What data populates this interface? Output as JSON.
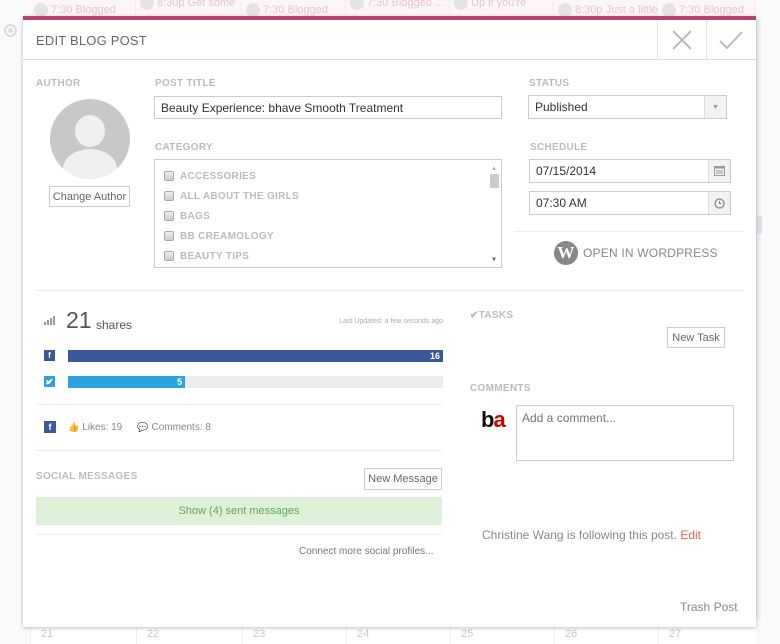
{
  "background": {
    "events": [
      {
        "time": "7:30",
        "text": "Blogged"
      },
      {
        "time": "8:30p",
        "text": "Get some"
      },
      {
        "time": "7:30",
        "text": "Blogged"
      },
      {
        "time": "7:30",
        "text": "Blogged ..."
      },
      {
        "time": "",
        "text": "Up if you're"
      },
      {
        "time": "8:30p",
        "text": "Just a little"
      },
      {
        "time": "7:30",
        "text": "Blogged"
      }
    ],
    "days": [
      "21",
      "22",
      "23",
      "24",
      "25",
      "26",
      "27"
    ]
  },
  "modal": {
    "title": "EDIT BLOG POST",
    "accent_color": "#b5426f",
    "close_icon": "close-icon",
    "confirm_icon": "check-icon"
  },
  "author": {
    "label": "AUTHOR",
    "change_button": "Change Author"
  },
  "post": {
    "title_label": "POST TITLE",
    "title_value": "Beauty Experience: bhave Smooth Treatment",
    "category_label": "CATEGORY",
    "categories": [
      {
        "name": "ACCESSORIES",
        "checked": false
      },
      {
        "name": "ALL ABOUT THE GIRLS",
        "checked": false
      },
      {
        "name": "BAGS",
        "checked": false
      },
      {
        "name": "BB CREAMOLOGY",
        "checked": false
      },
      {
        "name": "BEAUTY TIPS",
        "checked": false
      }
    ]
  },
  "status": {
    "label": "STATUS",
    "value": "Published"
  },
  "schedule": {
    "label": "SCHEDULE",
    "date": "07/15/2014",
    "time": "07:30 AM"
  },
  "wordpress": {
    "label": "OPEN IN WORDPRESS"
  },
  "shares": {
    "total": "21",
    "label": "shares",
    "last_updated": "Last Updated: a few seconds ago",
    "networks": [
      {
        "name": "facebook",
        "icon": "f",
        "value": 16,
        "max": 16,
        "color": "#3b5998",
        "display": "16"
      },
      {
        "name": "twitter",
        "icon": "t",
        "value": 5,
        "max": 16,
        "color": "#2ba3e1",
        "display": "5"
      }
    ],
    "facebook_stats": {
      "likes": "Likes: 19",
      "comments": "Comments: 8"
    }
  },
  "social_messages": {
    "label": "SOCIAL MESSAGES",
    "new_button": "New Message",
    "show_sent": "Show (4) sent messages",
    "connect_link": "Connect more social profiles..."
  },
  "tasks": {
    "label": "TASKS",
    "new_button": "New Task"
  },
  "comments": {
    "label": "COMMENTS",
    "placeholder": "Add a comment...",
    "avatar_text_b": "b",
    "avatar_text_a": "a"
  },
  "following": {
    "text": "Christine Wang is following this post.",
    "edit_link": "Edit"
  },
  "trash": "Trash Post"
}
